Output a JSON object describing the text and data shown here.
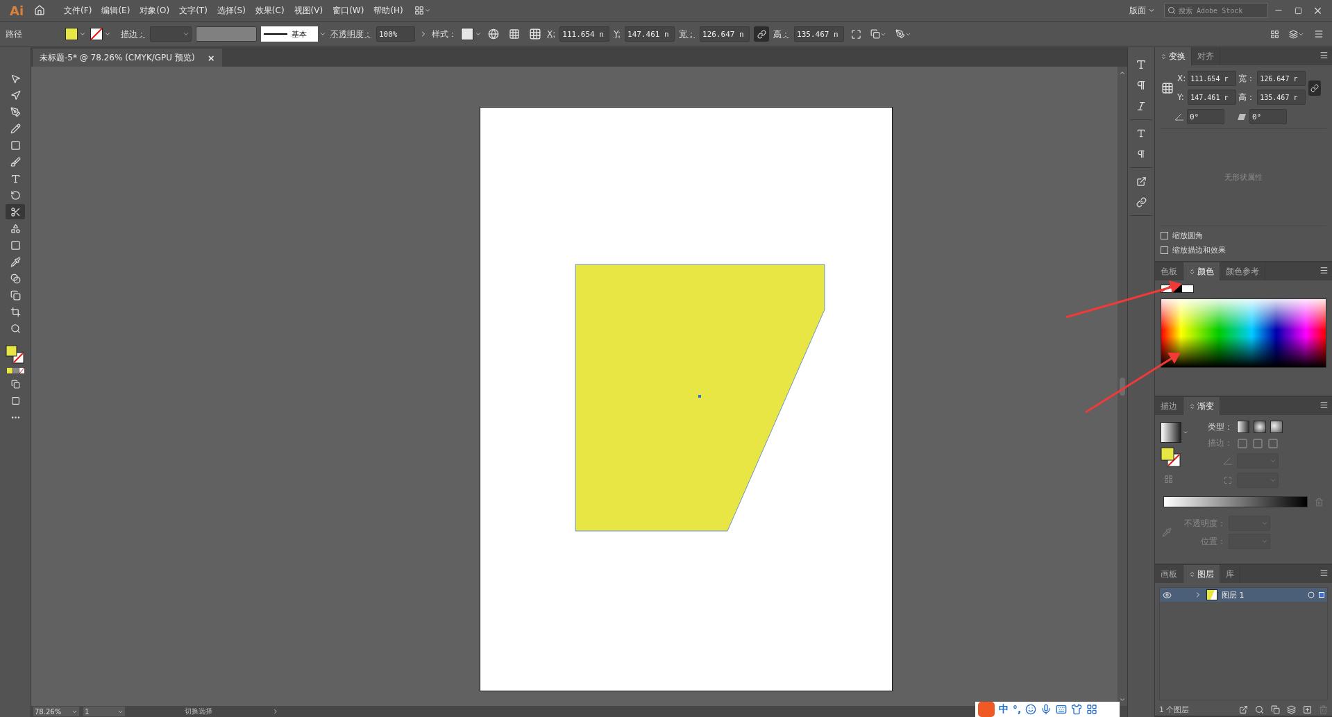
{
  "menu_bar": {
    "logo": "Ai",
    "items": [
      "文件(F)",
      "编辑(E)",
      "对象(O)",
      "文字(T)",
      "选择(S)",
      "效果(C)",
      "视图(V)",
      "窗口(W)",
      "帮助(H)"
    ],
    "workspace": "版面",
    "search": {
      "placeholder": "搜索 Adobe Stock"
    }
  },
  "control_bar": {
    "selection": "路径",
    "stroke_label": "描边：",
    "stroke_profile": "基本",
    "opacity_label": "不透明度：",
    "opacity": "100%",
    "style_label": "样式：",
    "x_label": "X:",
    "x": "111.654 n",
    "y_label": "Y:",
    "y": "147.461 n",
    "width_label": "宽：",
    "width": "126.647 n",
    "height_label": "高：",
    "height": "135.467 n"
  },
  "document_tab": {
    "title": "未标题-5* @ 78.26% (CMYK/GPU 预览)",
    "close": "×"
  },
  "tools": [
    {
      "kind": "selection",
      "selected": false
    },
    {
      "kind": "direct",
      "selected": false
    },
    {
      "kind": "pen",
      "selected": false
    },
    {
      "kind": "pencil",
      "selected": false
    },
    {
      "kind": "rectangle",
      "selected": false
    },
    {
      "kind": "brush",
      "selected": false
    },
    {
      "kind": "type",
      "selected": false
    },
    {
      "kind": "rotate",
      "selected": false
    },
    {
      "kind": "scissors",
      "selected": true
    },
    {
      "kind": "shapes",
      "selected": false
    },
    {
      "kind": "gradient",
      "selected": false
    },
    {
      "kind": "eyedropper",
      "selected": false
    },
    {
      "kind": "blend",
      "selected": false
    },
    {
      "kind": "symbol",
      "selected": false
    },
    {
      "kind": "artboard",
      "selected": false
    },
    {
      "kind": "zoom",
      "selected": false
    }
  ],
  "transform_panel": {
    "tabs": [
      {
        "label": "变换",
        "selected": true
      },
      {
        "label": "对齐",
        "selected": false
      }
    ],
    "x_label": "X:",
    "x": "111.654 r",
    "width_label": "宽：",
    "width": "126.647 r",
    "y_label": "Y:",
    "y": "147.461 r",
    "height_label": "高：",
    "height": "135.467 r",
    "angle": "0°",
    "shear": "0°",
    "empty_message": "无形状属性",
    "options": [
      {
        "label": "缩放圆角",
        "checked": false
      },
      {
        "label": "缩放描边和效果",
        "checked": false
      }
    ]
  },
  "color_panel": {
    "tabs": [
      {
        "label": "色板",
        "selected": false
      },
      {
        "label": "颜色",
        "selected": true
      },
      {
        "label": "颜色参考",
        "selected": false
      }
    ]
  },
  "gradient_panel": {
    "tabs": [
      {
        "label": "描边",
        "selected": false
      },
      {
        "label": "渐变",
        "selected": true
      }
    ],
    "rows": [
      {
        "kind": "type",
        "label": "类型：",
        "disabled": false
      },
      {
        "kind": "stroke",
        "label": "描边：",
        "disabled": true
      }
    ],
    "stop_fields": [
      {
        "label": "不透明度：",
        "disabled": true
      },
      {
        "label": "位置：",
        "disabled": true
      }
    ]
  },
  "layers_panel": {
    "tabs": [
      {
        "label": "画板",
        "selected": false
      },
      {
        "label": "图层",
        "selected": true
      },
      {
        "label": "库",
        "selected": false
      }
    ],
    "layers": [
      {
        "name": "图层 1",
        "selected": true,
        "expanded": false
      }
    ],
    "footer": "1 个图层"
  },
  "status_bar": {
    "zoom": "78.26%",
    "artboard": "1",
    "status": "切换选择"
  },
  "input_method_bar": {
    "mode": "中",
    "punctuation": "°,"
  }
}
